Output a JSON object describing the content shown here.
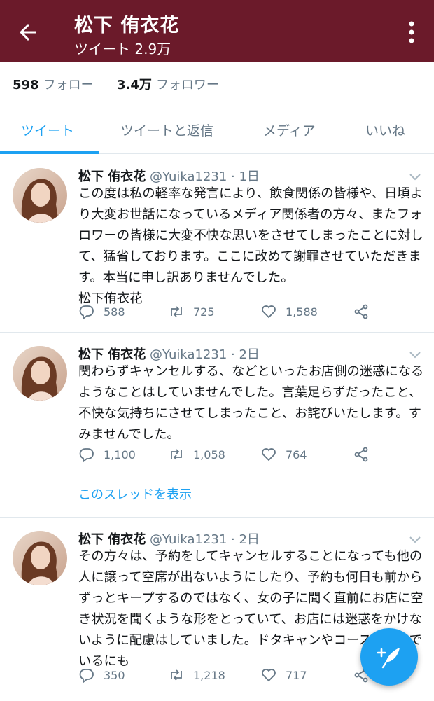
{
  "header": {
    "title": "松下 侑衣花",
    "tweet_count": "ツイート 2.9万"
  },
  "stats": {
    "following_num": "598",
    "following_label": "フォロー",
    "followers_num": "3.4万",
    "followers_label": "フォロワー"
  },
  "tabs": [
    {
      "label": "ツイート",
      "active": true
    },
    {
      "label": "ツイートと返信",
      "active": false
    },
    {
      "label": "メディア",
      "active": false
    },
    {
      "label": "いいね",
      "active": false
    }
  ],
  "tweets": [
    {
      "name": "松下 侑衣花",
      "meta": "@Yuika1231 · 1日",
      "text": "この度は私の軽率な発言により、飲食関係の皆様や、日頃より大変お世話になっているメディア関係者の方々、またフォロワーの皆様に大変不快な思いをさせてしまったことに対して、猛省しております。ここに改めて謝罪させていただきます。本当に申し訳ありませんでした。\n松下侑衣花",
      "replies": "588",
      "retweets": "725",
      "likes": "1,588"
    },
    {
      "name": "松下 侑衣花",
      "meta": "@Yuika1231 · 2日",
      "text": "関わらずキャンセルする、などといったお店側の迷惑になるようなことはしていませんでした。言葉足らずだったこと、不快な気持ちにさせてしまったこと、お詫びいたします。すみませんでした。",
      "replies": "1,100",
      "retweets": "1,058",
      "likes": "764",
      "thread_link": "このスレッドを表示"
    },
    {
      "name": "松下 侑衣花",
      "meta": "@Yuika1231 · 2日",
      "text": "その方々は、予約をしてキャンセルすることになっても他の人に譲って空席が出ないようにしたり、予約も何日も前からずっとキープするのではなく、女の子に聞く直前にお店に空き状況を聞くような形をとっていて、お店には迷惑をかけないように配慮はしていました。ドタキャンやコースを頼んでいるにも",
      "replies": "350",
      "retweets": "1,218",
      "likes": "717"
    }
  ],
  "colors": {
    "header_bg": "#6b1a2a",
    "accent": "#1da1f2",
    "muted": "#657786"
  },
  "icons": [
    "back-arrow-icon",
    "more-vert-icon",
    "reply-icon",
    "retweet-icon",
    "like-icon",
    "share-icon",
    "compose-icon"
  ]
}
